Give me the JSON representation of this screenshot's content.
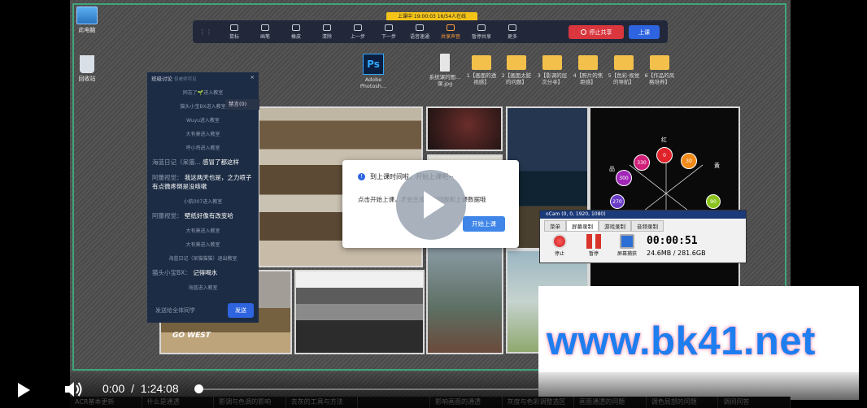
{
  "player": {
    "current_time": "0:00",
    "separator": "/",
    "duration": "1:24:08",
    "progress": 0.0
  },
  "desktop": {
    "icons": [
      {
        "label": "此电脑"
      },
      {
        "label": "回收站"
      }
    ],
    "files": [
      {
        "label": "Adobe Photosh..."
      },
      {
        "label": "系统课的图... 课.jpg"
      },
      {
        "label": "1【画面的透视感】"
      },
      {
        "label": "2【画面太脏的问题】"
      },
      {
        "label": "3【影调的层次分寻】"
      },
      {
        "label": "4【照片的焦距感】"
      },
      {
        "label": "5【色彩·视觉的导航】"
      },
      {
        "label": "6【作品的风格培养】"
      }
    ]
  },
  "live_tag": "上课中 19:00:03 16/54人在线",
  "toolbar": {
    "tools": [
      {
        "label": "鼠标",
        "hot": false
      },
      {
        "label": "画笔",
        "hot": false
      },
      {
        "label": "橡皮",
        "hot": false
      },
      {
        "label": "清除",
        "hot": false
      },
      {
        "label": "上一步",
        "hot": false
      },
      {
        "label": "下一步",
        "hot": false
      },
      {
        "label": "语音速通",
        "hot": false
      },
      {
        "label": "共享声音",
        "hot": true
      },
      {
        "label": "暂停共享",
        "hot": false
      },
      {
        "label": "更多",
        "hot": false
      }
    ],
    "stop_share": "停止共享",
    "start_class": "上课"
  },
  "chat": {
    "title": "班级讨论",
    "subtitle": "仅老师可见",
    "ban_button": "禁言(0)",
    "lines": [
      {
        "type": "sys",
        "text": "同志了🌱进入教室"
      },
      {
        "type": "sys",
        "text": "猫头小宝BX进入教室"
      },
      {
        "type": "sys",
        "text": "Wuyu进入教室"
      },
      {
        "type": "sys",
        "text": "大有莫进入教室"
      },
      {
        "type": "sys",
        "text": "呼小鸡进入教室"
      },
      {
        "type": "msg",
        "name": "海蓝日记（呆猫...",
        "text": "感冒了都这样"
      },
      {
        "type": "msg",
        "name": "阿蕾视觉：",
        "text": "我这两天也是，之力喷子有点微疼倒是没咳嗽"
      },
      {
        "type": "sys",
        "text": "小航007进入教室"
      },
      {
        "type": "msg",
        "name": "阿蕾视觉：",
        "text": "壁纸好像有改变哈"
      },
      {
        "type": "sys",
        "text": "大有莫进入教室"
      },
      {
        "type": "sys",
        "text": "大有莫进入教室"
      },
      {
        "type": "sys",
        "text": "海蓝日记（呆猫猫猫）退出教室"
      },
      {
        "type": "msg",
        "name": "猫头小宝BX：",
        "text": "记得喝水"
      },
      {
        "type": "sys",
        "text": "海蓝进入教室"
      }
    ],
    "input_placeholder": "发送给全体同学",
    "send": "发送"
  },
  "photo_text": "GO WEST",
  "color_wheel": [
    {
      "label": "红",
      "value": "0",
      "color": "#e0232a"
    },
    {
      "label": "",
      "value": "30",
      "color": "#f08a18"
    },
    {
      "label": "黄",
      "value": "",
      "color": ""
    },
    {
      "label": "",
      "value": "330",
      "color": "#d0207a"
    },
    {
      "label": "品",
      "value": "",
      "color": ""
    },
    {
      "label": "",
      "value": "300",
      "color": "#a026b8"
    },
    {
      "label": "",
      "value": "90",
      "color": "#8cc21e"
    },
    {
      "label": "",
      "value": "270",
      "color": "#6a3cc8"
    }
  ],
  "dialog": {
    "title": "到上课时间啦，开始上课吧~",
    "body": "点击开始上课，才会生成课后回放和上课数据哦",
    "button": "开始上课"
  },
  "ocam": {
    "title": "oCam (0, 0, 1920, 1080)",
    "tabs": [
      "菜单",
      "屏幕录制",
      "游戏录制",
      "音频录制"
    ],
    "active_tab": 1,
    "buttons": [
      "停止",
      "暂停",
      "屏幕捕获"
    ],
    "time": "00:00:51",
    "size": "24.6MB / 281.6GB"
  },
  "watermark": "www.bk41.net",
  "chapters": [
    "ACR基本更新",
    "什么是通透",
    "影调与色调的影响",
    "去灰的工具与方法",
    "",
    "影响画面的通透",
    "灰度与色彩调整选区",
    "画面通透的问题",
    "调色局部的问题",
    "调间问答"
  ],
  "colors": {
    "accent_blue": "#2f64e0",
    "stop_red": "#d9363e",
    "frame_green": "#3fa57a",
    "watermark_blue": "#1e7ef0"
  }
}
